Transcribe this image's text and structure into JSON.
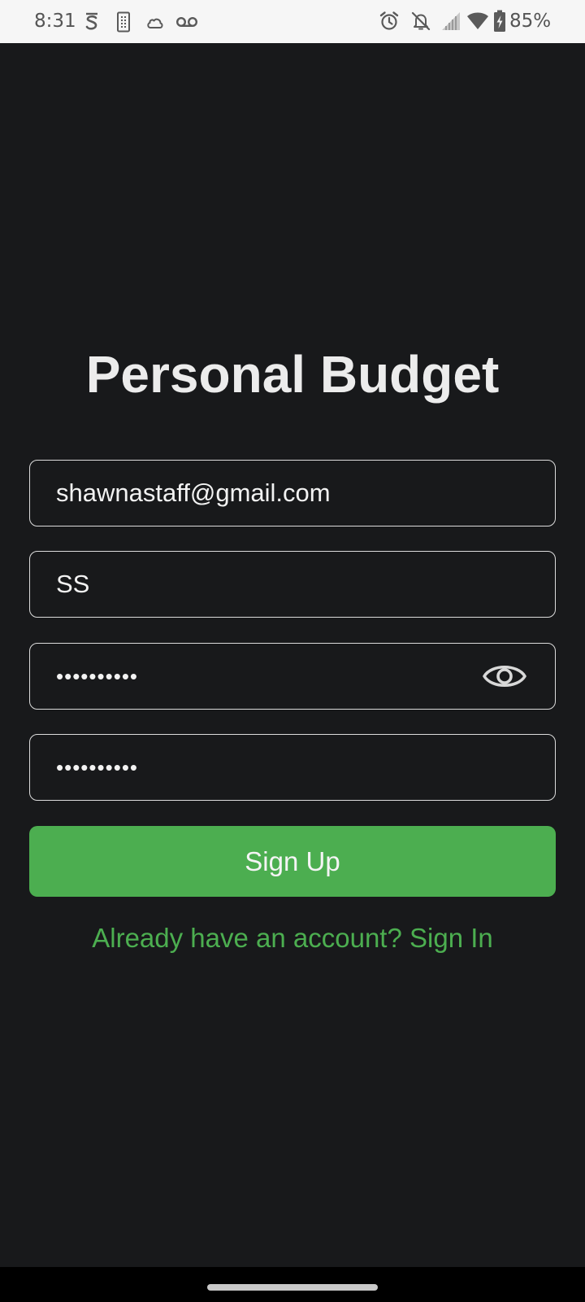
{
  "status_bar": {
    "time": "8:31",
    "battery": "85%",
    "left_icons": [
      "s-notification-icon",
      "sim-card-icon",
      "cloud-icon",
      "voicemail-icon"
    ],
    "right_icons": [
      "alarm-icon",
      "notifications-off-icon",
      "signal-icon",
      "wifi-icon",
      "battery-charging-icon"
    ]
  },
  "app": {
    "title": "Personal Budget"
  },
  "form": {
    "email_value": "shawnastaff@gmail.com",
    "name_value": "SS",
    "password_value": "••••••••••",
    "confirm_password_value": "••••••••••",
    "password_toggle_icon": "eye-icon",
    "signup_label": "Sign Up",
    "signin_link": "Already have an account? Sign In"
  },
  "colors": {
    "background": "#18191b",
    "accent": "#4cae50",
    "field_border": "#dcdcdc"
  }
}
